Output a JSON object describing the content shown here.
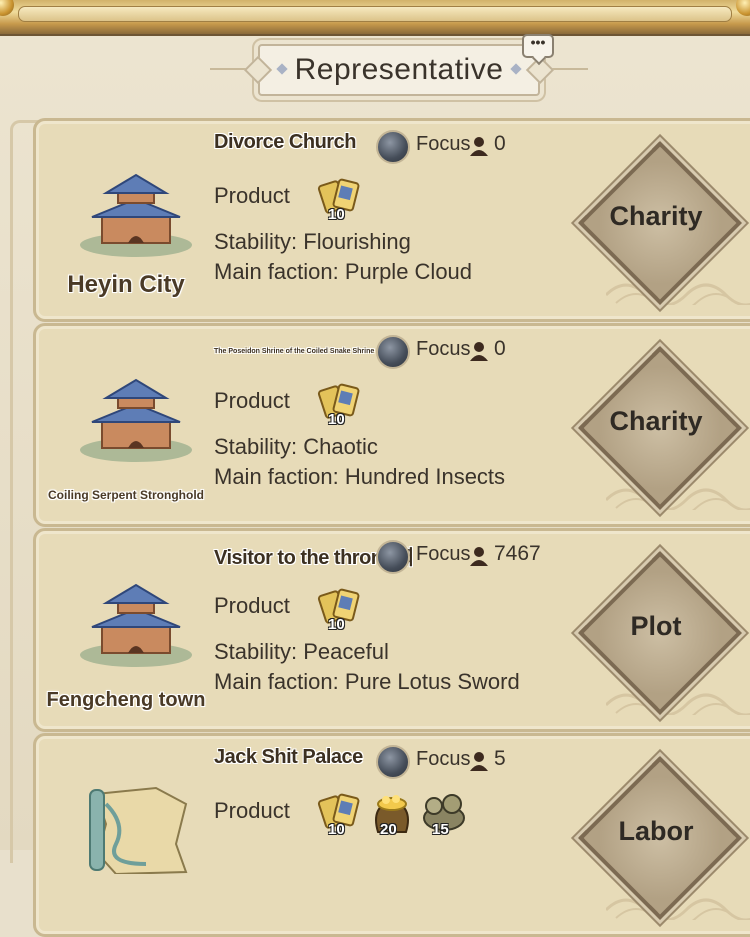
{
  "header": {
    "title": "Representative",
    "chat_icon_text": "•••"
  },
  "cards": [
    {
      "city": "Heyin City",
      "holder": "Divorce Church",
      "focus_label": "Focus",
      "focus_count": "0",
      "product_label": "Product",
      "items": [
        {
          "icon": "scroll-bundle-icon",
          "qty": "10"
        }
      ],
      "stability": "Stability: Flourishing",
      "faction": "Main faction: Purple Cloud",
      "action": "Charity",
      "city_art": "pagoda-icon"
    },
    {
      "city": "Coiling Serpent Stronghold",
      "holder": "The Poseidon Shrine of the Coiled Snake Shrine",
      "focus_label": "Focus",
      "focus_count": "0",
      "product_label": "Product",
      "items": [
        {
          "icon": "scroll-bundle-icon",
          "qty": "10"
        }
      ],
      "stability": "Stability: Chaotic",
      "faction": "Main faction: Hundred Insects",
      "action": "Charity",
      "city_art": "pagoda-icon"
    },
    {
      "city": "Fengcheng town",
      "holder": "Visitor to the throne渊",
      "focus_label": "Focus",
      "focus_count": "7467",
      "product_label": "Product",
      "items": [
        {
          "icon": "scroll-bundle-icon",
          "qty": "10"
        }
      ],
      "stability": "Stability: Peaceful",
      "faction": "Main faction: Pure Lotus Sword",
      "action": "Plot",
      "city_art": "pagoda-icon"
    },
    {
      "city": "",
      "holder": "Jack Shit Palace",
      "focus_label": "Focus",
      "focus_count": "5",
      "product_label": "Product",
      "items": [
        {
          "icon": "scroll-bundle-icon",
          "qty": "10"
        },
        {
          "icon": "gold-pouch-icon",
          "qty": "20"
        },
        {
          "icon": "ore-bundle-icon",
          "qty": "15"
        }
      ],
      "stability": "",
      "faction": "",
      "action": "Labor",
      "city_art": "map-scroll-icon"
    }
  ],
  "colors": {
    "card_bg": "#e7dbb8",
    "border": "#c9b891",
    "action_button": "#b2a184",
    "text": "#3a332b"
  }
}
